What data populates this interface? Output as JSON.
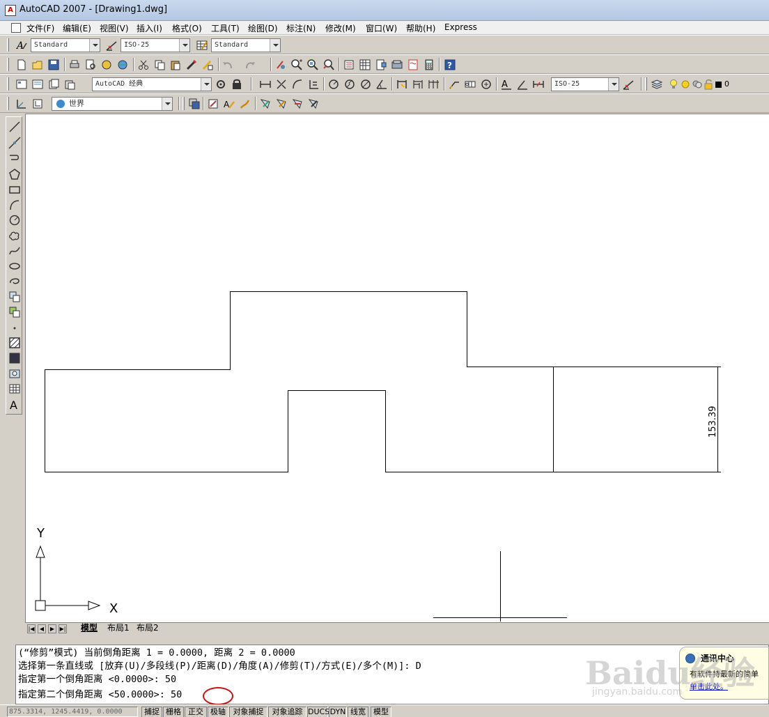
{
  "window": {
    "title": "AutoCAD 2007 - [Drawing1.dwg]",
    "app_icon": "autocad-app-icon"
  },
  "menu": {
    "items": [
      "文件(F)",
      "编辑(E)",
      "视图(V)",
      "插入(I)",
      "格式(O)",
      "工具(T)",
      "绘图(D)",
      "标注(N)",
      "修改(M)",
      "窗口(W)",
      "帮助(H)",
      "Express"
    ]
  },
  "styles_toolbar": {
    "text_style": "Standard",
    "dim_style": "ISO-25",
    "table_style": "Standard"
  },
  "workspace_toolbar": {
    "workspace": "AutoCAD 经典"
  },
  "dim_toolbar": {
    "dim_style": "ISO-25"
  },
  "layers_toolbar": {
    "layer": "0"
  },
  "ucs_toolbar": {
    "ucs": "世界"
  },
  "drawing": {
    "dimension_text": "153.39",
    "ucs_y_label": "Y",
    "ucs_x_label": "X"
  },
  "layout_tabs": [
    "模型",
    "布局1",
    "布局2"
  ],
  "command": {
    "lines": [
      "(“修剪”模式) 当前倒角距离 1 = 0.0000, 距离 2 = 0.0000",
      "选择第一条直线或 [放弃(U)/多段线(P)/距离(D)/角度(A)/修剪(T)/方式(E)/多个(M)]:  D",
      "指定第一个倒角距离 <0.0000>: 50",
      "指定第二个倒角距离 <50.0000>: 50"
    ],
    "highlight_color": "#d01010"
  },
  "status": {
    "coordinates": "875.3314, 1245.4419, 0.0000",
    "buttons": [
      "捕捉",
      "栅格",
      "正交",
      "极轴",
      "对象捕捉",
      "对象追踪",
      "DUCS",
      "DYN",
      "线宽",
      "模型"
    ]
  },
  "comm_center": {
    "title": "通讯中心",
    "body": "有软件持最新的简单",
    "link": "单击此处。"
  },
  "watermark": {
    "text": "Baidu经验",
    "sub": "jingyan.baidu.com"
  }
}
